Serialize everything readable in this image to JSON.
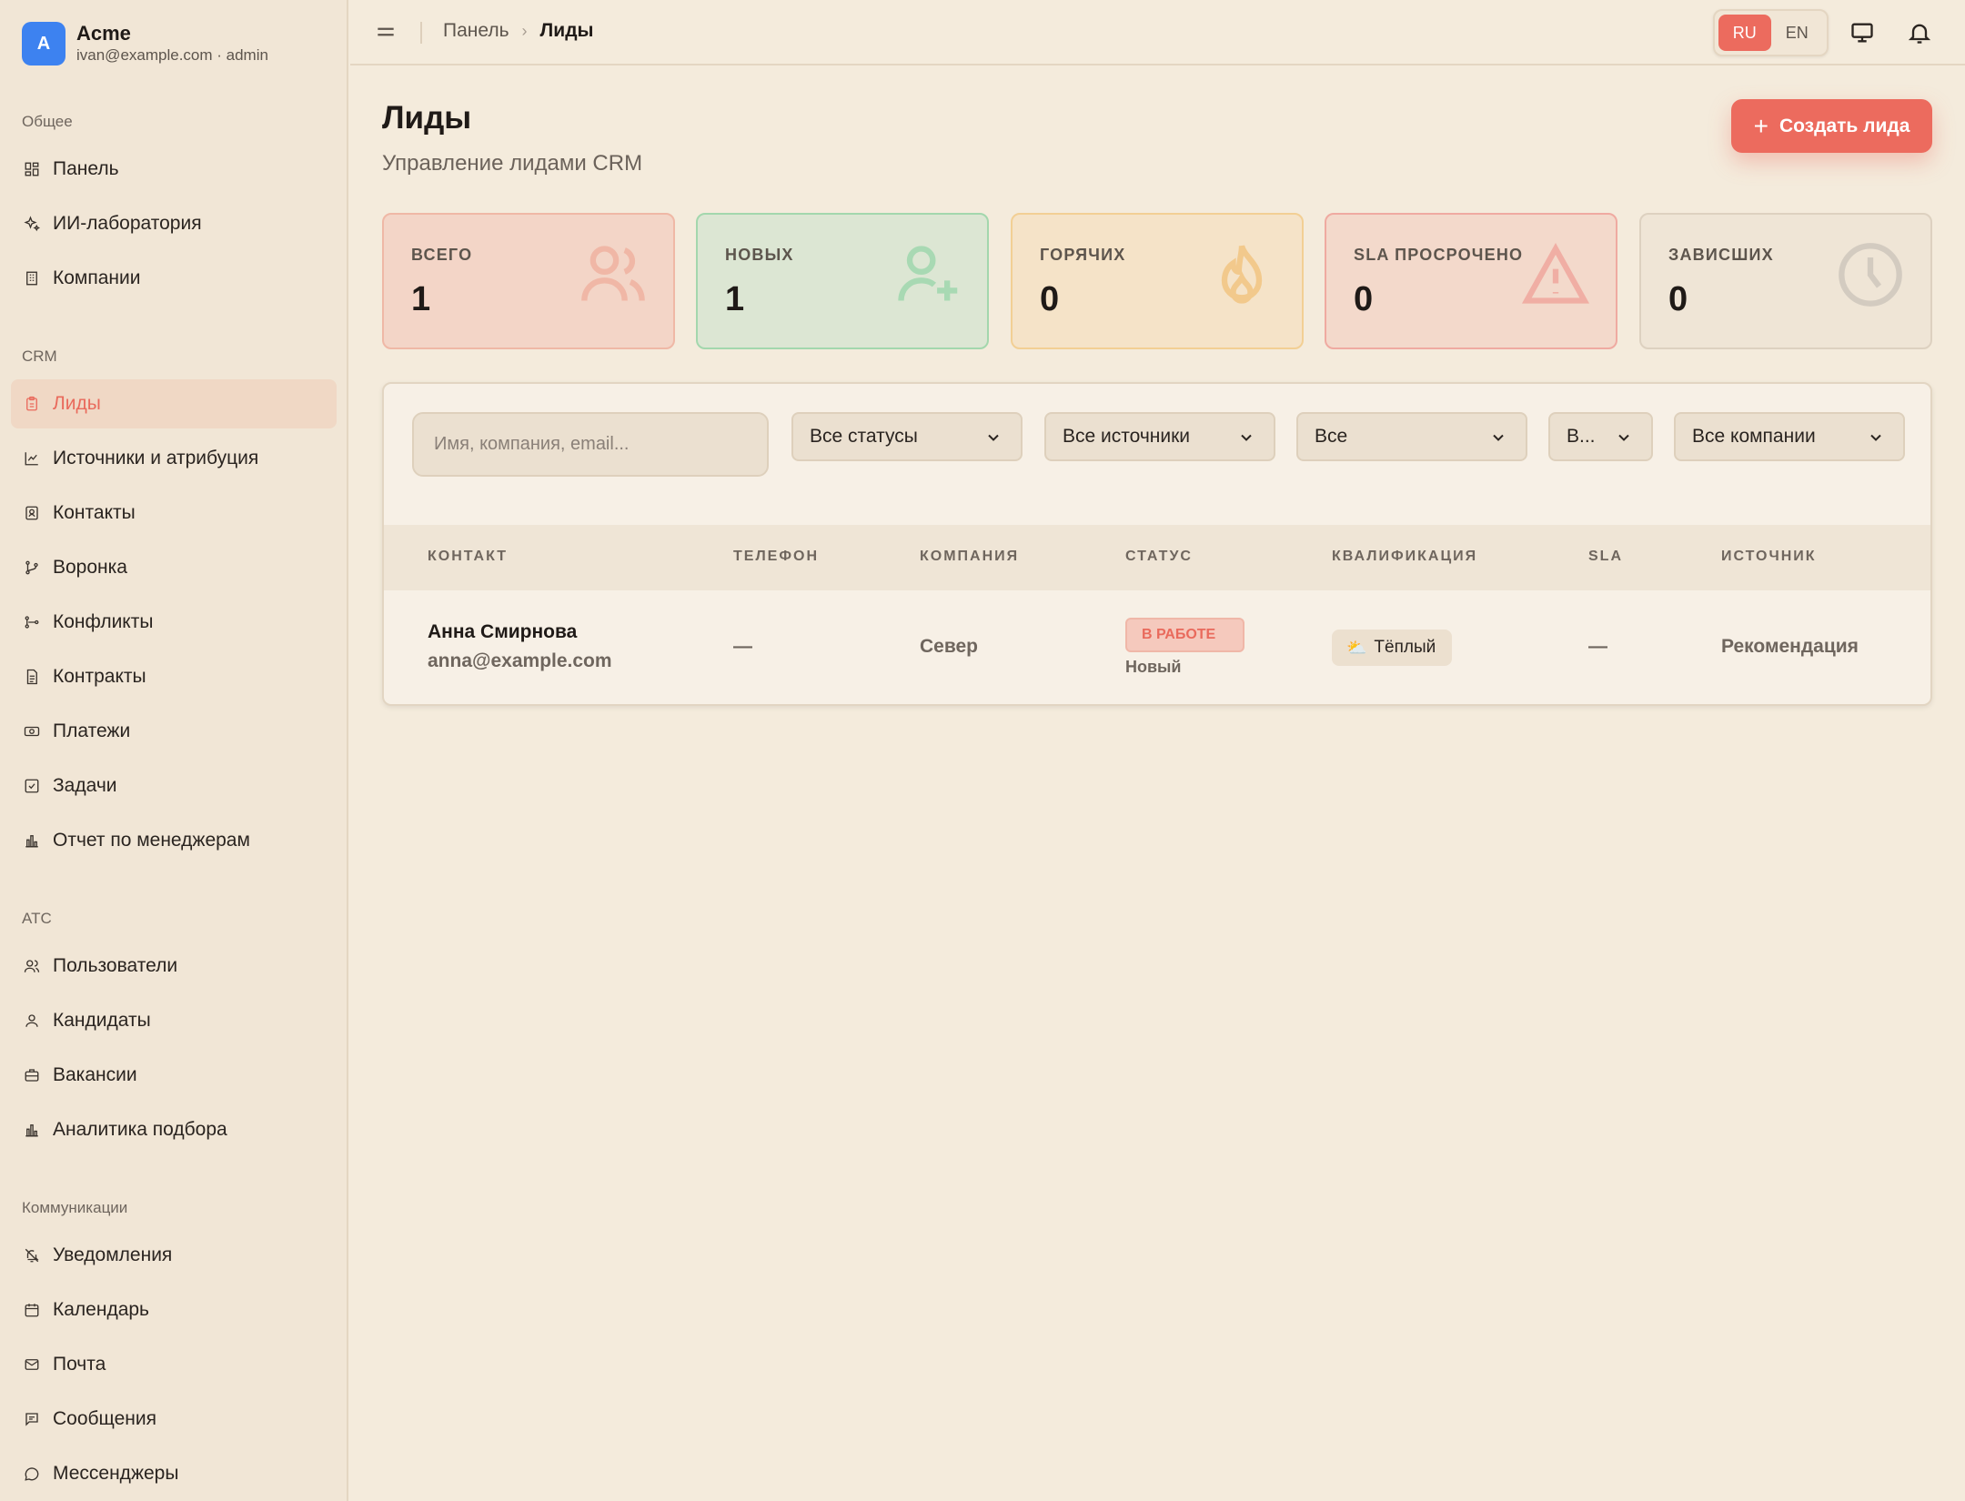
{
  "brand": {
    "logo_letter": "A",
    "name": "Acme",
    "subtitle": "ivan@example.com · admin"
  },
  "sidebar": {
    "sections": [
      {
        "title": "Общее",
        "items": [
          {
            "label": "Панель",
            "icon": "dashboard-icon"
          },
          {
            "label": "ИИ-лаборатория",
            "icon": "sparkles-icon"
          },
          {
            "label": "Компании",
            "icon": "building-icon"
          }
        ]
      },
      {
        "title": "CRM",
        "items": [
          {
            "label": "Лиды",
            "icon": "clipboard-icon",
            "active": true
          },
          {
            "label": "Источники и атрибуция",
            "icon": "chart-icon"
          },
          {
            "label": "Контакты",
            "icon": "contact-icon"
          },
          {
            "label": "Воронка",
            "icon": "funnel-icon"
          },
          {
            "label": "Конфликты",
            "icon": "git-branch-icon"
          },
          {
            "label": "Контракты",
            "icon": "document-icon"
          },
          {
            "label": "Платежи",
            "icon": "banknote-icon"
          },
          {
            "label": "Задачи",
            "icon": "checkbox-icon"
          },
          {
            "label": "Отчет по менеджерам",
            "icon": "bar-chart-icon"
          }
        ]
      },
      {
        "title": "ATC",
        "items": [
          {
            "label": "Пользователи",
            "icon": "users-icon"
          },
          {
            "label": "Кандидаты",
            "icon": "user-icon"
          },
          {
            "label": "Вакансии",
            "icon": "briefcase-icon"
          },
          {
            "label": "Аналитика подбора",
            "icon": "bar-chart-icon"
          }
        ]
      },
      {
        "title": "Коммуникации",
        "items": [
          {
            "label": "Уведомления",
            "icon": "bell-off-icon"
          },
          {
            "label": "Календарь",
            "icon": "calendar-icon"
          },
          {
            "label": "Почта",
            "icon": "mail-icon"
          },
          {
            "label": "Сообщения",
            "icon": "message-square-icon"
          },
          {
            "label": "Мессенджеры",
            "icon": "message-circle-icon"
          }
        ]
      }
    ]
  },
  "topbar": {
    "breadcrumb": {
      "parent": "Панель",
      "separator": "›",
      "current": "Лиды"
    },
    "languages": [
      {
        "code": "RU",
        "active": true
      },
      {
        "code": "EN",
        "active": false
      }
    ]
  },
  "page": {
    "title": "Лиды",
    "subtitle": "Управление лидами CRM",
    "create_button": {
      "plus": "+",
      "label": "Создать лида"
    }
  },
  "stats": [
    {
      "label": "ВСЕГО",
      "value": "1",
      "icon": "users-icon",
      "bg": "#f3d5c7",
      "border": "#efb8a6",
      "icon_color": "#f0b7a6"
    },
    {
      "label": "НОВЫХ",
      "value": "1",
      "icon": "user-plus-icon",
      "bg": "#dce6d3",
      "border": "#a3d7ad",
      "icon_color": "#a8d9b3"
    },
    {
      "label": "ГОРЯЧИХ",
      "value": "0",
      "icon": "flame-icon",
      "bg": "#f5e3c8",
      "border": "#f2cf94",
      "icon_color": "#f2c98c"
    },
    {
      "label": "SLA ПРОСРОЧЕНО",
      "value": "0",
      "icon": "alert-triangle-icon",
      "bg": "#f3d9cb",
      "border": "#efaaa1",
      "icon_color": "#f0aea4"
    },
    {
      "label": "ЗАВИСШИХ",
      "value": "0",
      "icon": "clock-icon",
      "bg": "#efe5d6",
      "border": "#ddd1c0",
      "icon_color": "#d3cbc0"
    }
  ],
  "filters": {
    "search_placeholder": "Имя, компания, email...",
    "status": "Все статусы",
    "source": "Все источники",
    "qualification": "Все",
    "sla": "В...",
    "company": "Все компании"
  },
  "table": {
    "columns": [
      "КОНТАКТ",
      "ТЕЛЕФОН",
      "КОМПАНИЯ",
      "СТАТУС",
      "КВАЛИФИКАЦИЯ",
      "SLA",
      "ИСТОЧНИК"
    ],
    "rows": [
      {
        "name": "Анна Смирнова",
        "email": "anna@example.com",
        "phone": "—",
        "company": "Север",
        "status": "В РАБОТЕ",
        "status_sub": "Новый",
        "qualification_icon": "⛅",
        "qualification": "Тёплый",
        "sla": "—",
        "source": "Рекомендация"
      }
    ]
  }
}
